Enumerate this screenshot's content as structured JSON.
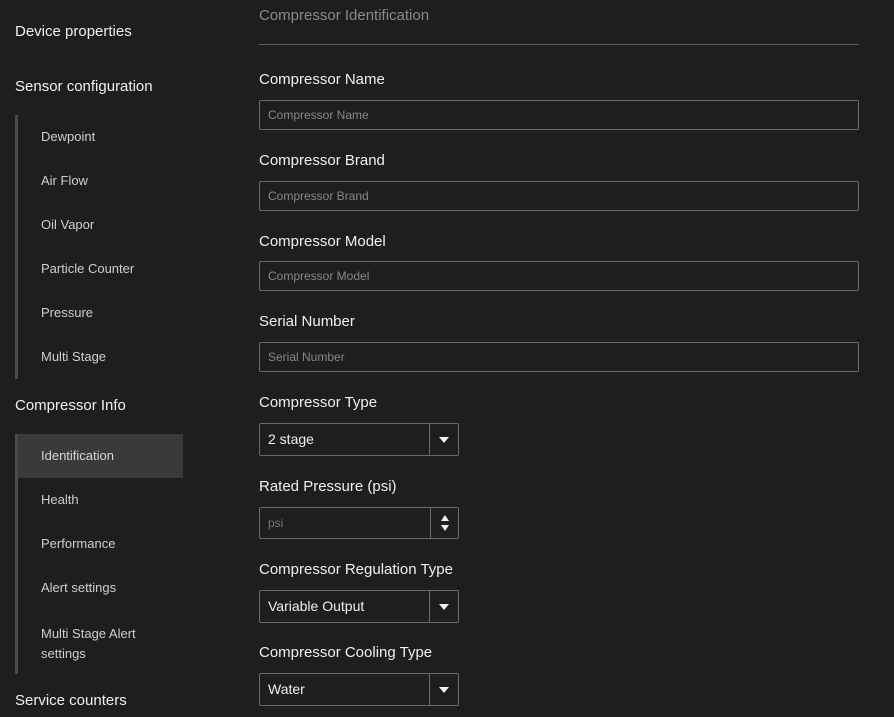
{
  "sidebar": {
    "device_properties": "Device properties",
    "sensor_configuration": {
      "title": "Sensor configuration",
      "items": [
        "Dewpoint",
        "Air Flow",
        "Oil Vapor",
        "Particle Counter",
        "Pressure",
        "Multi Stage"
      ]
    },
    "compressor_info": {
      "title": "Compressor Info",
      "items": [
        "Identification",
        "Health",
        "Performance",
        "Alert settings"
      ],
      "multi_stage_alert_line1": "Multi Stage Alert",
      "multi_stage_alert_line2": "settings",
      "active": "Identification"
    },
    "service_counters": "Service counters"
  },
  "main": {
    "heading": "Compressor Identification",
    "compressor_name": {
      "label": "Compressor Name",
      "placeholder": "Compressor Name",
      "value": ""
    },
    "compressor_brand": {
      "label": "Compressor Brand",
      "placeholder": "Compressor Brand",
      "value": ""
    },
    "compressor_model": {
      "label": "Compressor Model",
      "placeholder": "Compressor Model",
      "value": ""
    },
    "serial_number": {
      "label": "Serial Number",
      "placeholder": "Serial Number",
      "value": ""
    },
    "compressor_type": {
      "label": "Compressor Type",
      "value": "2 stage"
    },
    "rated_pressure": {
      "label": "Rated Pressure (psi)",
      "placeholder": "psi",
      "value": ""
    },
    "regulation_type": {
      "label": "Compressor Regulation Type",
      "value": "Variable Output"
    },
    "cooling_type": {
      "label": "Compressor Cooling Type",
      "value": "Water"
    }
  },
  "colors": {
    "background": "#1e1e1e",
    "active_item": "#3a3a3a",
    "border": "#6a6a6a",
    "muted_text": "#8a8a8a"
  }
}
